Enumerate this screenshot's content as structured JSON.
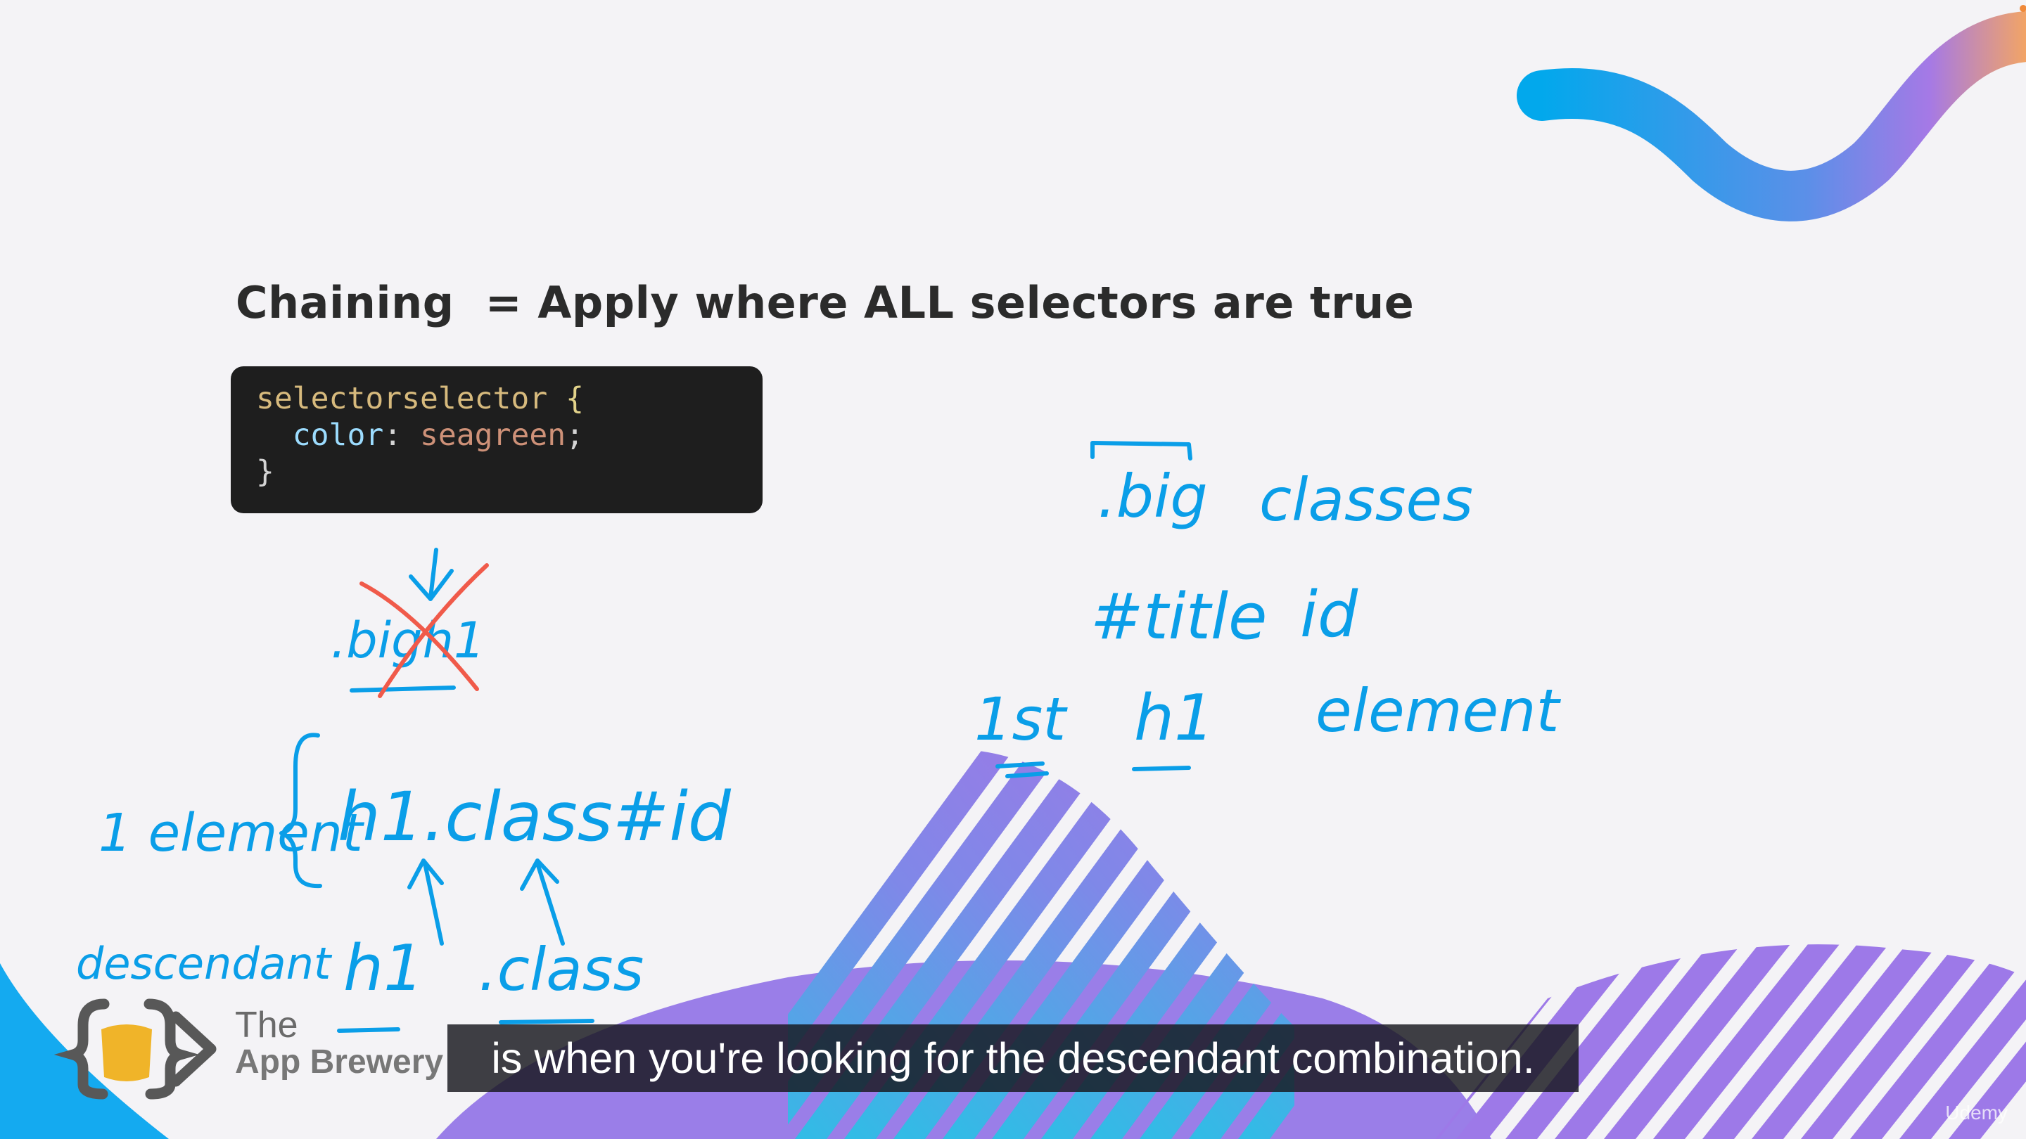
{
  "slide": {
    "title": "Chaining  = Apply where ALL selectors are true"
  },
  "code": {
    "line1_selector": "selectorselector",
    "line1_brace": " {",
    "line2_indent": "  ",
    "line2_property": "color",
    "line2_colon": ": ",
    "line2_value": "seagreen",
    "line2_semicolon": ";",
    "line3_brace": "}"
  },
  "brand": {
    "the": "The",
    "name": "App Brewery"
  },
  "caption": {
    "text": "is when you're looking for the descendant combination."
  },
  "watermark": {
    "text": "Udemy"
  },
  "handwriting": {
    "crossed_example": ".bigh1",
    "left_label": "1 element",
    "chain_example": "h1.class#id",
    "descendant_label": "descendant",
    "descendant_h1": "h1",
    "descendant_class": ".class",
    "big": ".big",
    "classes": "classes",
    "title": "#title",
    "id": "id",
    "first": "1st",
    "h1": "h1",
    "element": "element"
  },
  "colors": {
    "background": "#f4f3f6",
    "ink_blue": "#0a9ee8",
    "ink_red": "#f05a4a",
    "purple": "#9a7ee8",
    "stripe_blue": "#39b6e8",
    "code_bg": "#1e1e1e",
    "caption_bg": "#16161c"
  },
  "icons": {
    "logo": "code-braces-beer-icon"
  }
}
